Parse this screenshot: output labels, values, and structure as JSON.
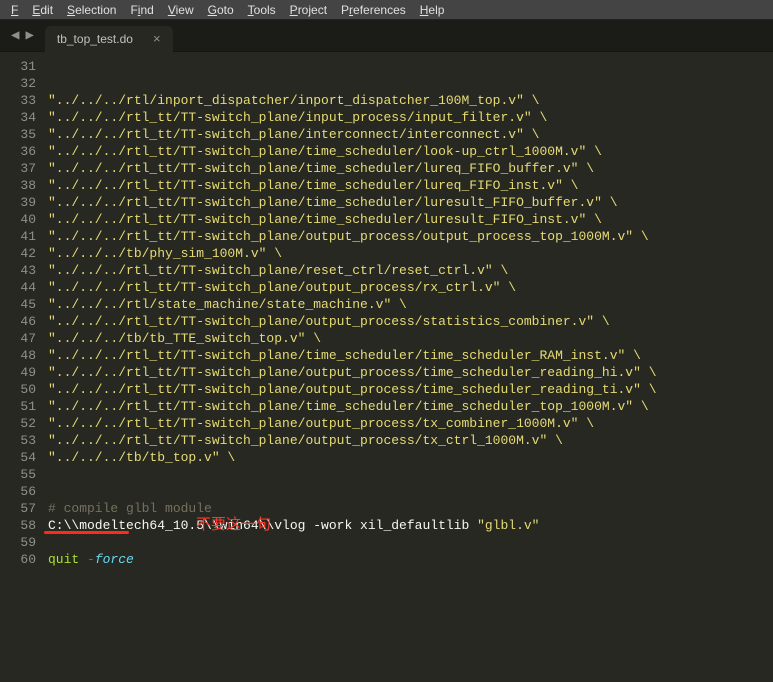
{
  "menubar": {
    "file": "File",
    "edit": "Edit",
    "selection": "Selection",
    "find": "Find",
    "view": "View",
    "goto": "Goto",
    "tools": "Tools",
    "project": "Project",
    "preferences": "Preferences",
    "help": "Help"
  },
  "tab": {
    "title": "tb_top_test.do"
  },
  "annotation": "不要这一句",
  "lines": [
    {
      "n": "31",
      "t": "str",
      "text": "\"../../../rtl/inport_dispatcher/inport_dispatcher_100M_top.v\" \\"
    },
    {
      "n": "32",
      "t": "str",
      "text": "\"../../../rtl_tt/TT-switch_plane/input_process/input_filter.v\" \\"
    },
    {
      "n": "33",
      "t": "str",
      "text": "\"../../../rtl_tt/TT-switch_plane/interconnect/interconnect.v\" \\"
    },
    {
      "n": "34",
      "t": "str",
      "text": "\"../../../rtl_tt/TT-switch_plane/time_scheduler/look-up_ctrl_1000M.v\" \\"
    },
    {
      "n": "35",
      "t": "str",
      "text": "\"../../../rtl_tt/TT-switch_plane/time_scheduler/lureq_FIFO_buffer.v\" \\"
    },
    {
      "n": "36",
      "t": "str",
      "text": "\"../../../rtl_tt/TT-switch_plane/time_scheduler/lureq_FIFO_inst.v\" \\"
    },
    {
      "n": "37",
      "t": "str",
      "text": "\"../../../rtl_tt/TT-switch_plane/time_scheduler/luresult_FIFO_buffer.v\" \\"
    },
    {
      "n": "38",
      "t": "str",
      "text": "\"../../../rtl_tt/TT-switch_plane/time_scheduler/luresult_FIFO_inst.v\" \\"
    },
    {
      "n": "39",
      "t": "str",
      "text": "\"../../../rtl_tt/TT-switch_plane/output_process/output_process_top_1000M.v\" \\"
    },
    {
      "n": "40",
      "t": "str",
      "text": "\"../../../tb/phy_sim_100M.v\" \\"
    },
    {
      "n": "41",
      "t": "str",
      "text": "\"../../../rtl_tt/TT-switch_plane/reset_ctrl/reset_ctrl.v\" \\"
    },
    {
      "n": "42",
      "t": "str",
      "text": "\"../../../rtl_tt/TT-switch_plane/output_process/rx_ctrl.v\" \\"
    },
    {
      "n": "43",
      "t": "str",
      "text": "\"../../../rtl/state_machine/state_machine.v\" \\"
    },
    {
      "n": "44",
      "t": "str",
      "text": "\"../../../rtl_tt/TT-switch_plane/output_process/statistics_combiner.v\" \\"
    },
    {
      "n": "45",
      "t": "str",
      "text": "\"../../../tb/tb_TTE_switch_top.v\" \\"
    },
    {
      "n": "46",
      "t": "str",
      "text": "\"../../../rtl_tt/TT-switch_plane/time_scheduler/time_scheduler_RAM_inst.v\" \\"
    },
    {
      "n": "47",
      "t": "str",
      "text": "\"../../../rtl_tt/TT-switch_plane/output_process/time_scheduler_reading_hi.v\" \\"
    },
    {
      "n": "48",
      "t": "str",
      "text": "\"../../../rtl_tt/TT-switch_plane/output_process/time_scheduler_reading_ti.v\" \\"
    },
    {
      "n": "49",
      "t": "str",
      "text": "\"../../../rtl_tt/TT-switch_plane/time_scheduler/time_scheduler_top_1000M.v\" \\"
    },
    {
      "n": "50",
      "t": "str",
      "text": "\"../../../rtl_tt/TT-switch_plane/output_process/tx_combiner_1000M.v\" \\"
    },
    {
      "n": "51",
      "t": "str",
      "text": "\"../../../rtl_tt/TT-switch_plane/output_process/tx_ctrl_1000M.v\" \\"
    },
    {
      "n": "52",
      "t": "str",
      "text": "\"../../../tb/tb_top.v\" \\"
    },
    {
      "n": "53",
      "t": "plain",
      "text": ""
    },
    {
      "n": "54",
      "t": "plain",
      "text": ""
    },
    {
      "n": "55",
      "t": "cmt",
      "text": "# compile glbl module"
    },
    {
      "n": "56",
      "t": "mixed56",
      "text": ""
    },
    {
      "n": "57",
      "t": "plain",
      "text": ""
    },
    {
      "n": "58",
      "t": "quit",
      "text": ""
    },
    {
      "n": "59",
      "t": "plain",
      "text": ""
    },
    {
      "n": "60",
      "t": "plain",
      "text": ""
    }
  ],
  "line56": {
    "prefix": "C:\\\\modeltech64_10.5\\\\win64\\\\vlog -work xil_defaultlib ",
    "string": "\"glbl.v\""
  },
  "quit_line": {
    "quit": "quit",
    "dash": " -",
    "force": "force"
  }
}
